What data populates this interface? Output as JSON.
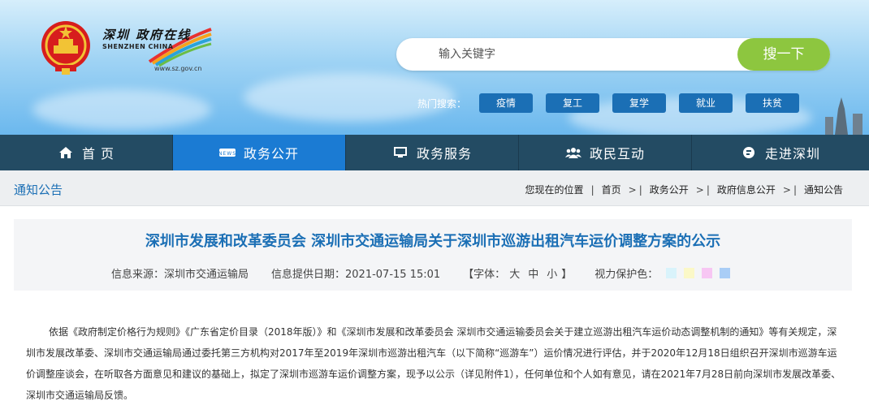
{
  "header": {
    "emblem_icon": "national-emblem-icon",
    "logo": {
      "cn": "深圳 政府在线",
      "en": "SHENZHEN CHINA",
      "url": "www.sz.gov.cn"
    },
    "search": {
      "placeholder": "输入关键字",
      "button_label": "搜一下"
    },
    "hot_search": {
      "label": "热门搜索：",
      "tags": [
        "疫情",
        "复工",
        "复学",
        "就业",
        "扶贫"
      ]
    }
  },
  "nav": [
    {
      "label": "首 页",
      "icon": "home-icon"
    },
    {
      "label": "政务公开",
      "icon": "news-icon"
    },
    {
      "label": "政务服务",
      "icon": "monitor-icon"
    },
    {
      "label": "政民互动",
      "icon": "people-icon"
    },
    {
      "label": "走进深圳",
      "icon": "chat-icon"
    }
  ],
  "nav_active_index": 1,
  "breadcrumb": {
    "section_title": "通知公告",
    "prefix": "您现在的位置",
    "items": [
      "首页",
      "政务公开",
      "政府信息公开",
      "通知公告"
    ],
    "separator": ">"
  },
  "article": {
    "title": "深圳市发展和改革委员会 深圳市交通运输局关于深圳市巡游出租汽车运价调整方案的公示",
    "source": "信息来源：深圳市交通运输局",
    "date": "信息提供日期：2021-07-15 15:01",
    "font_size_label": "【字体：",
    "font_sizes": [
      "大",
      "中",
      "小"
    ],
    "font_size_close": "】",
    "eye_care_label": "视力保护色：",
    "eye_care_colors": [
      "#d9f3fb",
      "#fbf8c7",
      "#f7c6f3",
      "#a9cdf6"
    ],
    "body": "依据《政府制定价格行为规则》《广东省定价目录（2018年版）》和《深圳市发展和改革委员会 深圳市交通运输委员会关于建立巡游出租汽车运价动态调整机制的通知》等有关规定，深圳市发展改革委、深圳市交通运输局通过委托第三方机构对2017年至2019年深圳市巡游出租汽车（以下简称“巡游车”）运价情况进行评估，并于2020年12月18日组织召开深圳市巡游车运价调整座谈会，在听取各方面意见和建议的基础上，拟定了深圳市巡游车运价调整方案，现予以公示（详见附件1），任何单位和个人如有意见，请在2021年7月28日前向深圳市发展改革委、深圳市交通运输局反馈。"
  },
  "colors": {
    "accent_blue": "#1b6fb5",
    "nav_bg": "#234b63",
    "nav_active": "#1b7bd3",
    "search_button": "#8dc63f"
  }
}
